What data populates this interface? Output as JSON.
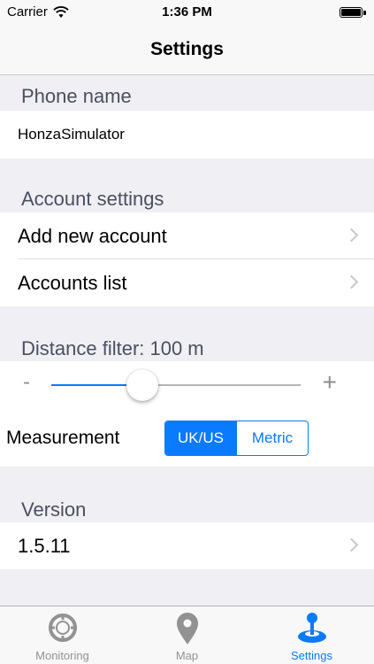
{
  "status_bar": {
    "carrier": "Carrier",
    "time": "1:36 PM"
  },
  "nav": {
    "title": "Settings"
  },
  "sections": {
    "phone": {
      "header": "Phone name",
      "value": "HonzaSimulator"
    },
    "account": {
      "header": "Account settings",
      "items": [
        {
          "label": "Add new account"
        },
        {
          "label": "Accounts list"
        }
      ]
    },
    "distance": {
      "header": "Distance filter: 100 m",
      "minus": "-",
      "plus": "+",
      "slider_value_fraction": 0.33,
      "measurement_label": "Measurement",
      "options": [
        "UK/US",
        "Metric"
      ],
      "selected": "UK/US"
    },
    "version": {
      "header": "Version",
      "value": "1.5.11"
    }
  },
  "tabs": [
    {
      "label": "Monitoring",
      "icon": "crosshair-icon",
      "active": false
    },
    {
      "label": "Map",
      "icon": "map-pin-icon",
      "active": false
    },
    {
      "label": "Settings",
      "icon": "joystick-icon",
      "active": true
    }
  ],
  "colors": {
    "accent": "#0a7aff",
    "background": "#efeff4",
    "header_text": "#4a5060"
  }
}
